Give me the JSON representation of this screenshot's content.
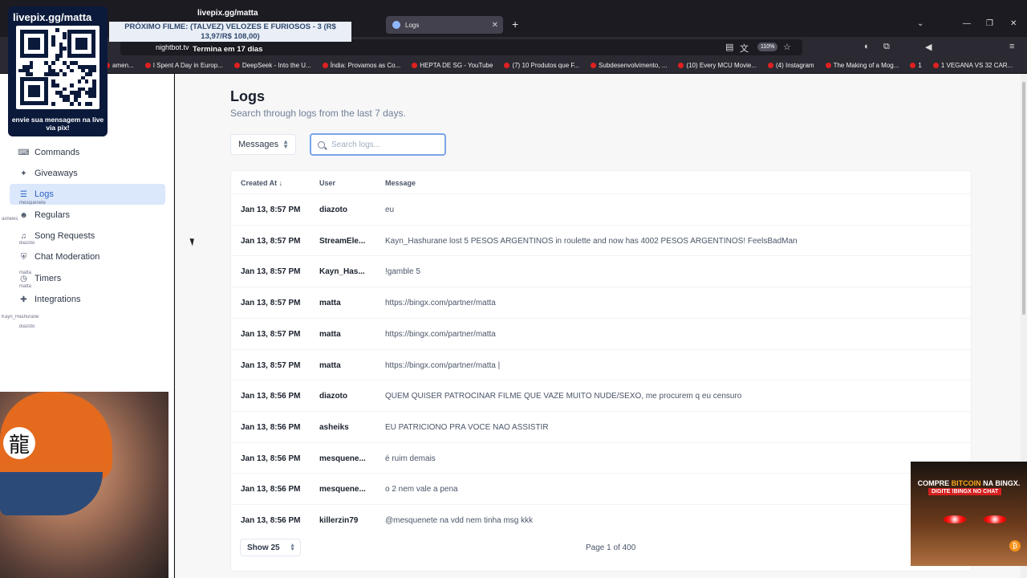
{
  "browser": {
    "active_tab_title": "Logs",
    "url": "nightbot.tv",
    "zoom": "110%",
    "bookmarks": [
      "amen...",
      "I Spent A Day in Europ...",
      "DeepSeek - Into the U...",
      "Índia: Provamos as Co...",
      "HEPTA DE SG - YouTube",
      "(7) 10 Produtos que F...",
      "Subdesenvolvimento, ...",
      "(10) Every MCU Movie...",
      "(4) Instagram",
      "The Making of a Mog...",
      "1",
      "1 VEGANA VS 32 CAR..."
    ]
  },
  "sidebar": {
    "items": [
      {
        "label": "Commands",
        "icon": "terminal-icon"
      },
      {
        "label": "Giveaways",
        "icon": "party-icon"
      },
      {
        "label": "Logs",
        "icon": "list-icon",
        "active": true
      },
      {
        "label": "Regulars",
        "icon": "users-icon"
      },
      {
        "label": "Song Requests",
        "icon": "headphones-icon"
      },
      {
        "label": "Chat Moderation",
        "icon": "shield-icon"
      },
      {
        "label": "Timers",
        "icon": "clock-icon"
      },
      {
        "label": "Integrations",
        "icon": "puzzle-icon"
      }
    ]
  },
  "main": {
    "title": "Logs",
    "subtitle": "Search through logs from the last 7 days.",
    "filter_selected": "Messages",
    "search_placeholder": "Search logs...",
    "columns": [
      "Created At ↓",
      "User",
      "Message"
    ],
    "rows": [
      {
        "date": "Jan 13, 8:57 PM",
        "user": "diazoto",
        "message": "eu"
      },
      {
        "date": "Jan 13, 8:57 PM",
        "user": "StreamEle...",
        "message": "Kayn_Hashurane lost 5 PESOS ARGENTINOS in roulette and now has 4002 PESOS ARGENTINOS! FeelsBadMan"
      },
      {
        "date": "Jan 13, 8:57 PM",
        "user": "Kayn_Has...",
        "message": "!gamble 5"
      },
      {
        "date": "Jan 13, 8:57 PM",
        "user": "matta",
        "message": "https://bingx.com/partner/matta"
      },
      {
        "date": "Jan 13, 8:57 PM",
        "user": "matta",
        "message": "https://bingx.com/partner/matta"
      },
      {
        "date": "Jan 13, 8:57 PM",
        "user": "matta",
        "message": "https://bingx.com/partner/matta |"
      },
      {
        "date": "Jan 13, 8:56 PM",
        "user": "diazoto",
        "message": "QUEM QUISER PATROCINAR FILME QUE VAZE MUITO NUDE/SEXO, me procurem q eu censuro"
      },
      {
        "date": "Jan 13, 8:56 PM",
        "user": "asheiks",
        "message": "EU PATRICIONO PRA VOCE NAO ASSISTIR"
      },
      {
        "date": "Jan 13, 8:56 PM",
        "user": "mesquene...",
        "message": "é ruim demais"
      },
      {
        "date": "Jan 13, 8:56 PM",
        "user": "mesquene...",
        "message": "o 2 nem vale a pena"
      },
      {
        "date": "Jan 13, 8:56 PM",
        "user": "killerzin79",
        "message": "@mesquenete na vdd nem tinha msg kkk"
      }
    ],
    "page_size": "Show 25",
    "pagination": "Page 1 of 400"
  },
  "overlay": {
    "qr_title": "livepix.gg/matta",
    "qr_caption": "envie sua mensagem na live via pix!",
    "channel": "livepix.gg/matta",
    "banner": "PRÓXIMO FILME: (TALVEZ) VELOZES E FURIOSOS - 3 (R$ 13,97/R$ 108,00)",
    "banner_sub": "Termina em 17 dias",
    "chat_names": [
      "mesquenete",
      "asheiks",
      "diazoto",
      "matta",
      "matta",
      "Kayn_Hashurane",
      "diazoto"
    ],
    "ad_line1_a": "COMPRE ",
    "ad_line1_b": "BITCOIN",
    "ad_line1_c": " NA BINGX.",
    "ad_line2": "DIGITE !BINGX NO CHAT",
    "cap_kanji": "龍"
  },
  "colors": {
    "accent": "#2c62c9",
    "active_bg": "#dbe7fb",
    "overlay_navy": "#0b1a3b"
  }
}
